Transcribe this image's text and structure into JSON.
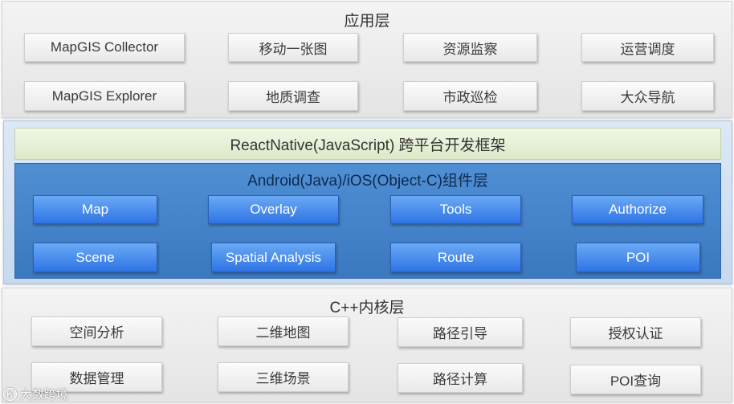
{
  "app_layer": {
    "title": "应用层",
    "items": [
      "MapGIS Collector",
      "移动一张图",
      "资源监察",
      "运营调度",
      "MapGIS Explorer",
      "地质调查",
      "市政巡检",
      "大众导航"
    ]
  },
  "framework": {
    "label": "ReactNative(JavaScript) 跨平台开发框架"
  },
  "component_layer": {
    "title": "Android(Java)/iOS(Object-C)组件层",
    "items": [
      "Map",
      "Overlay",
      "Tools",
      "Authorize",
      "Scene",
      "Spatial Analysis",
      "Route",
      "POI"
    ]
  },
  "core_layer": {
    "title": "C++内核层",
    "items": [
      "空间分析",
      "二维地图",
      "路径引导",
      "授权认证",
      "数据管理",
      "三维场景",
      "路径计算",
      "POI查询"
    ]
  },
  "watermark": {
    "logo": "K",
    "text": "大数跨境"
  }
}
